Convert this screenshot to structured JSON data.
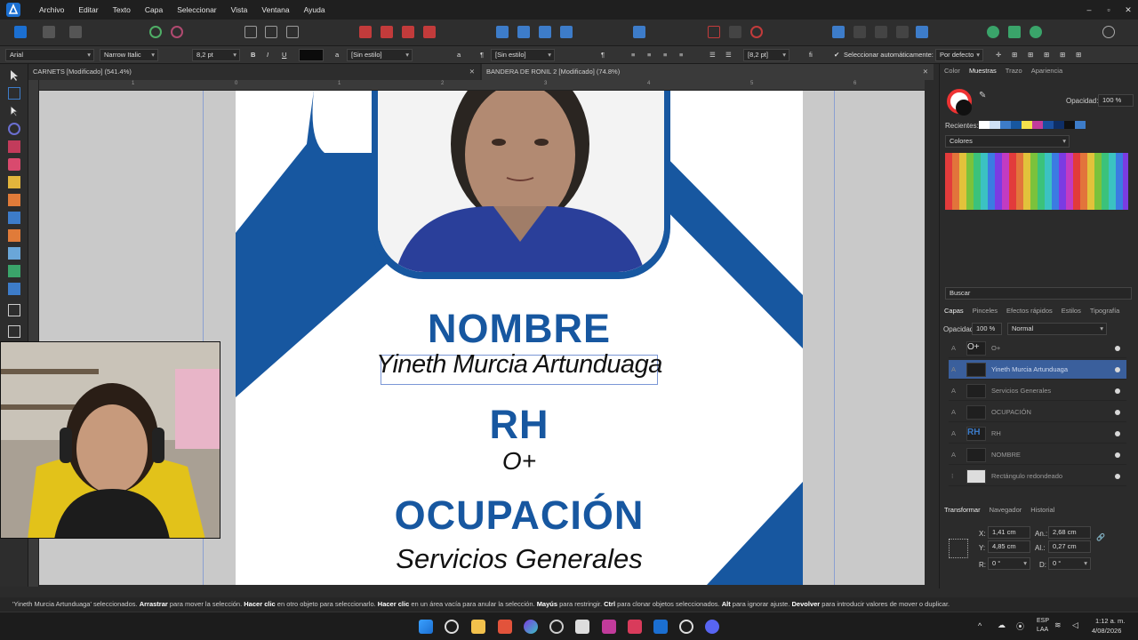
{
  "menubar": {
    "items": [
      "Archivo",
      "Editar",
      "Texto",
      "Capa",
      "Seleccionar",
      "Vista",
      "Ventana",
      "Ayuda"
    ],
    "controls": [
      "–",
      "▫",
      "✕"
    ]
  },
  "context": {
    "font_family": "Arial",
    "font_style": "Narrow Italic",
    "font_size": "8,2 pt",
    "bold": "B",
    "italic": "I",
    "underline": "U",
    "char_style_glyph": "a",
    "char_style": "[Sin estilo]",
    "para_glyph": "¶",
    "para_style": "[Sin estilo]",
    "para_size": "[8,2 pt]",
    "fi_label": "fi",
    "auto_select_label": "Seleccionar automáticamente:",
    "auto_select_value": "Por defecto"
  },
  "doctabs": [
    {
      "label": "CARNETS [Modificado] (541.4%)"
    },
    {
      "label": "BANDERA DE RONIL 2 [Modificado] (74.8%)"
    }
  ],
  "ruler": {
    "marks": [
      "1",
      "0",
      "1",
      "2",
      "3",
      "4",
      "5",
      "6",
      "7"
    ]
  },
  "card": {
    "name_heading": "NOMBRE",
    "name_value": "Yineth Murcia Artunduaga",
    "rh_heading": "RH",
    "rh_value": "O+",
    "job_heading": "OCUPACIÓN",
    "job_value": "Servicios Generales"
  },
  "colors": {
    "brand_blue": "#1757a0",
    "accent_blue": "#3d7cc9",
    "panel_bg": "#2b2b2b"
  },
  "swatches_panel": {
    "tabs": [
      "Color",
      "Muestras",
      "Trazo",
      "Apariencia"
    ],
    "opacity_label": "Opacidad:",
    "opacity_value": "100 %",
    "recent_label": "Recientes:",
    "palette_name": "Colores",
    "search_placeholder": "Buscar"
  },
  "layers_panel": {
    "tabs": [
      "Capas",
      "Pinceles",
      "Efectos rápidos",
      "Estilos",
      "Tipografía"
    ],
    "opacity_label": "Opacidad:",
    "opacity_value": "100 %",
    "blend_mode": "Normal",
    "layers": [
      {
        "name": "O+",
        "thumb": "O+"
      },
      {
        "name": "Yineth Murcia Artunduaga",
        "thumb": "",
        "selected": true
      },
      {
        "name": "Servicios Generales",
        "thumb": ""
      },
      {
        "name": "OCUPACIÓN",
        "thumb": ""
      },
      {
        "name": "RH",
        "thumb": "RH"
      },
      {
        "name": "NOMBRE",
        "thumb": ""
      },
      {
        "name": "Rectángulo redondeado",
        "thumb": ""
      }
    ]
  },
  "transform_panel": {
    "tabs": [
      "Transformar",
      "Navegador",
      "Historial"
    ],
    "x_label": "X:",
    "x_value": "1,41 cm",
    "y_label": "Y:",
    "y_value": "4,85 cm",
    "w_label": "An.:",
    "w_value": "2,68 cm",
    "h_label": "Al.:",
    "h_value": "0,27 cm",
    "r_label": "R:",
    "r_value": "0 °",
    "s_label": "D:",
    "s_value": "0 °"
  },
  "status": {
    "selected": "'Yineth Murcia Artunduaga' seleccionados.",
    "t1": "Arrastrar",
    "t1d": " para mover la selección. ",
    "t2": "Hacer clic",
    "t2d": " en otro objeto para seleccionarlo. ",
    "t3": "Hacer clic",
    "t3d": " en un área vacía para anular la selección. ",
    "t4": "Mayús",
    "t4d": " para restringir. ",
    "t5": "Ctrl",
    "t5d": " para clonar objetos seleccionados. ",
    "t6": "Alt",
    "t6d": " para ignorar ajuste. ",
    "t7": "Devolver",
    "t7d": " para introducir valores de mover o duplicar."
  },
  "taskbar": {
    "lang": "ESP",
    "lang2": "LAA",
    "time": "1:12 a. m.",
    "date": "4/08/2026"
  }
}
